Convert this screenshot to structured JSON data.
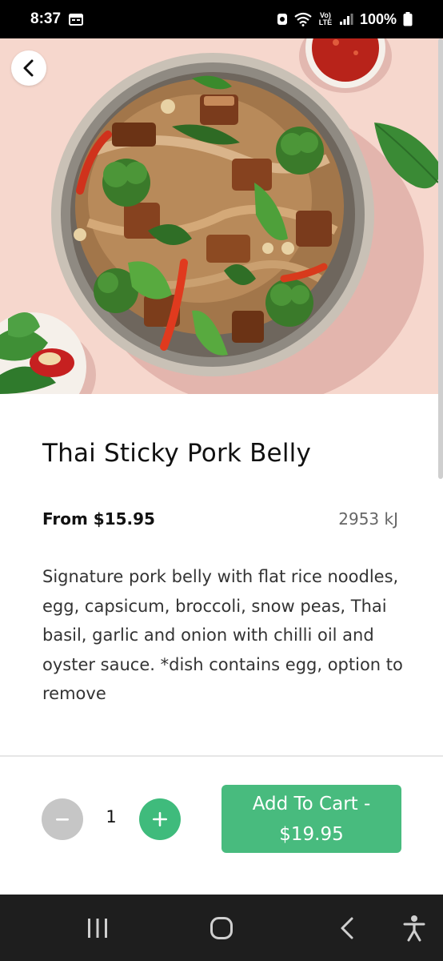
{
  "status_bar": {
    "time": "8:37",
    "network": "Vo) LTE",
    "battery": "100%"
  },
  "product": {
    "name": "Thai Sticky Pork Belly",
    "price_from": "From $15.95",
    "energy": "2953 kJ",
    "description": "Signature pork belly with flat rice noodles, egg, capsicum, broccoli, snow peas, Thai basil, garlic and onion with chilli oil and oyster sauce. *dish contains egg, option to remove"
  },
  "cart": {
    "quantity": "1",
    "add_line1": "Add To Cart -",
    "add_line2": "$19.95"
  },
  "colors": {
    "accent": "#48bb7e",
    "hero_bg": "#f6d7cd"
  }
}
